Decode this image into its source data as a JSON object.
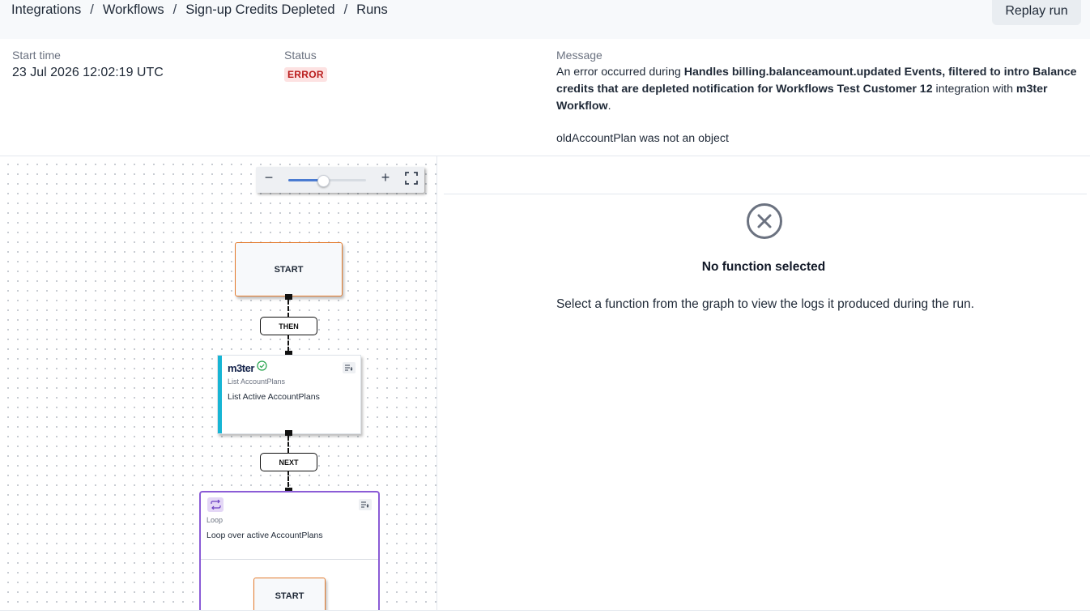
{
  "breadcrumb": {
    "items": [
      "Integrations",
      "Workflows",
      "Sign-up Credits Depleted",
      "Runs"
    ],
    "separator": "/"
  },
  "header": {
    "replay_label": "Replay run"
  },
  "run": {
    "start_time_label": "Start time",
    "start_time_value": "23 Jul 2026 12:02:19 UTC",
    "status_label": "Status",
    "status_value": "ERROR",
    "message_label": "Message",
    "message_prefix": "An error occurred during ",
    "message_event": "Handles billing.balanceamount.updated Events, filtered to intro Balance credits that are depleted notification for Workflows Test Customer 12",
    "message_middle": " integration with ",
    "message_integration": "m3ter Workflow",
    "message_suffix": ".",
    "error_detail": "oldAccountPlan was not an object"
  },
  "zoom": {
    "minus": "−",
    "plus": "+",
    "level": 0.45
  },
  "graph": {
    "start_label": "START",
    "then_label": "THEN",
    "next_label": "NEXT",
    "list_node": {
      "brand": "m3ter",
      "subtitle": "List AccountPlans",
      "title": "List Active AccountPlans"
    },
    "loop_node": {
      "subtitle": "Loop",
      "title": "Loop over active AccountPlans",
      "inner_start_label": "START"
    }
  },
  "detail": {
    "title": "No function selected",
    "description": "Select a function from the graph to view the logs it produced during the run."
  },
  "colors": {
    "error_bg": "#fde2e2",
    "error_text": "#b91c1c",
    "start_border": "#e37a2c",
    "function_bar": "#17b5d4",
    "loop_border": "#8b5cd6",
    "success": "#22a34a"
  }
}
